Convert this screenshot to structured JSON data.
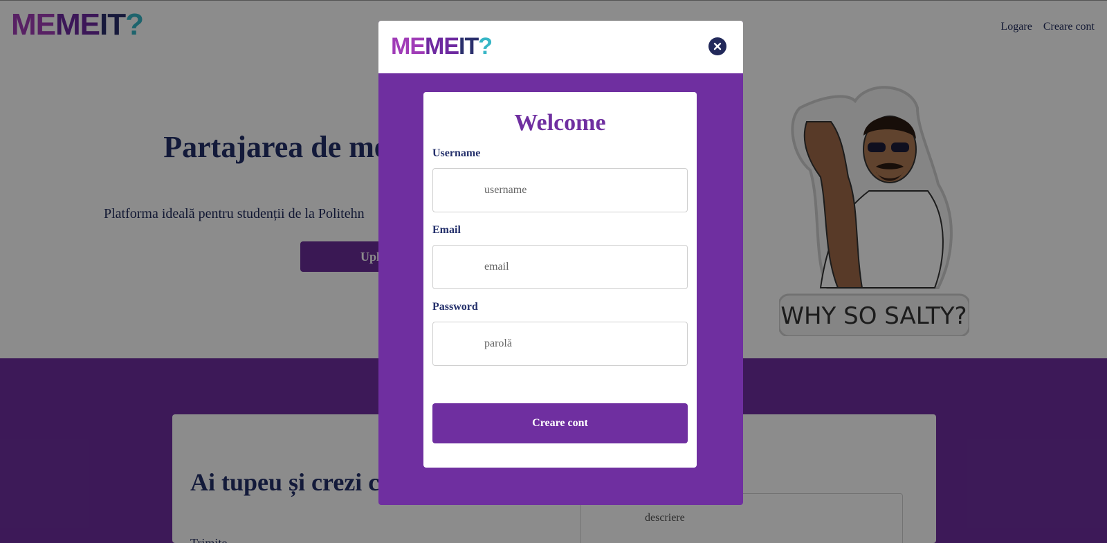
{
  "app": {
    "logo": {
      "part1": "ME",
      "part2": "ME",
      "part3": "IT",
      "part4": "?"
    }
  },
  "nav": {
    "login": "Logare",
    "register": "Creare cont"
  },
  "hero": {
    "title": "Partajarea de memes mai s",
    "subtitle": "Platforma ideală pentru studenții de la Politehn",
    "button": "Uploa"
  },
  "sticker": {
    "caption": "WHY SO SALTY?"
  },
  "section": {
    "title": "Ai tupeu și crezi c amuzant?",
    "text": "Trimite",
    "description_placeholder": "descriere"
  },
  "modal": {
    "heading": "Welcome",
    "username_label": "Username",
    "username_placeholder": "username",
    "email_label": "Email",
    "email_placeholder": "email",
    "password_label": "Password",
    "password_placeholder": "parolă",
    "submit": "Creare cont",
    "close_icon": "close-icon"
  },
  "colors": {
    "brand_purple": "#6f2fa0",
    "navy": "#24306b",
    "logo_pink": "#a03cb7",
    "logo_teal": "#37b6c6"
  }
}
